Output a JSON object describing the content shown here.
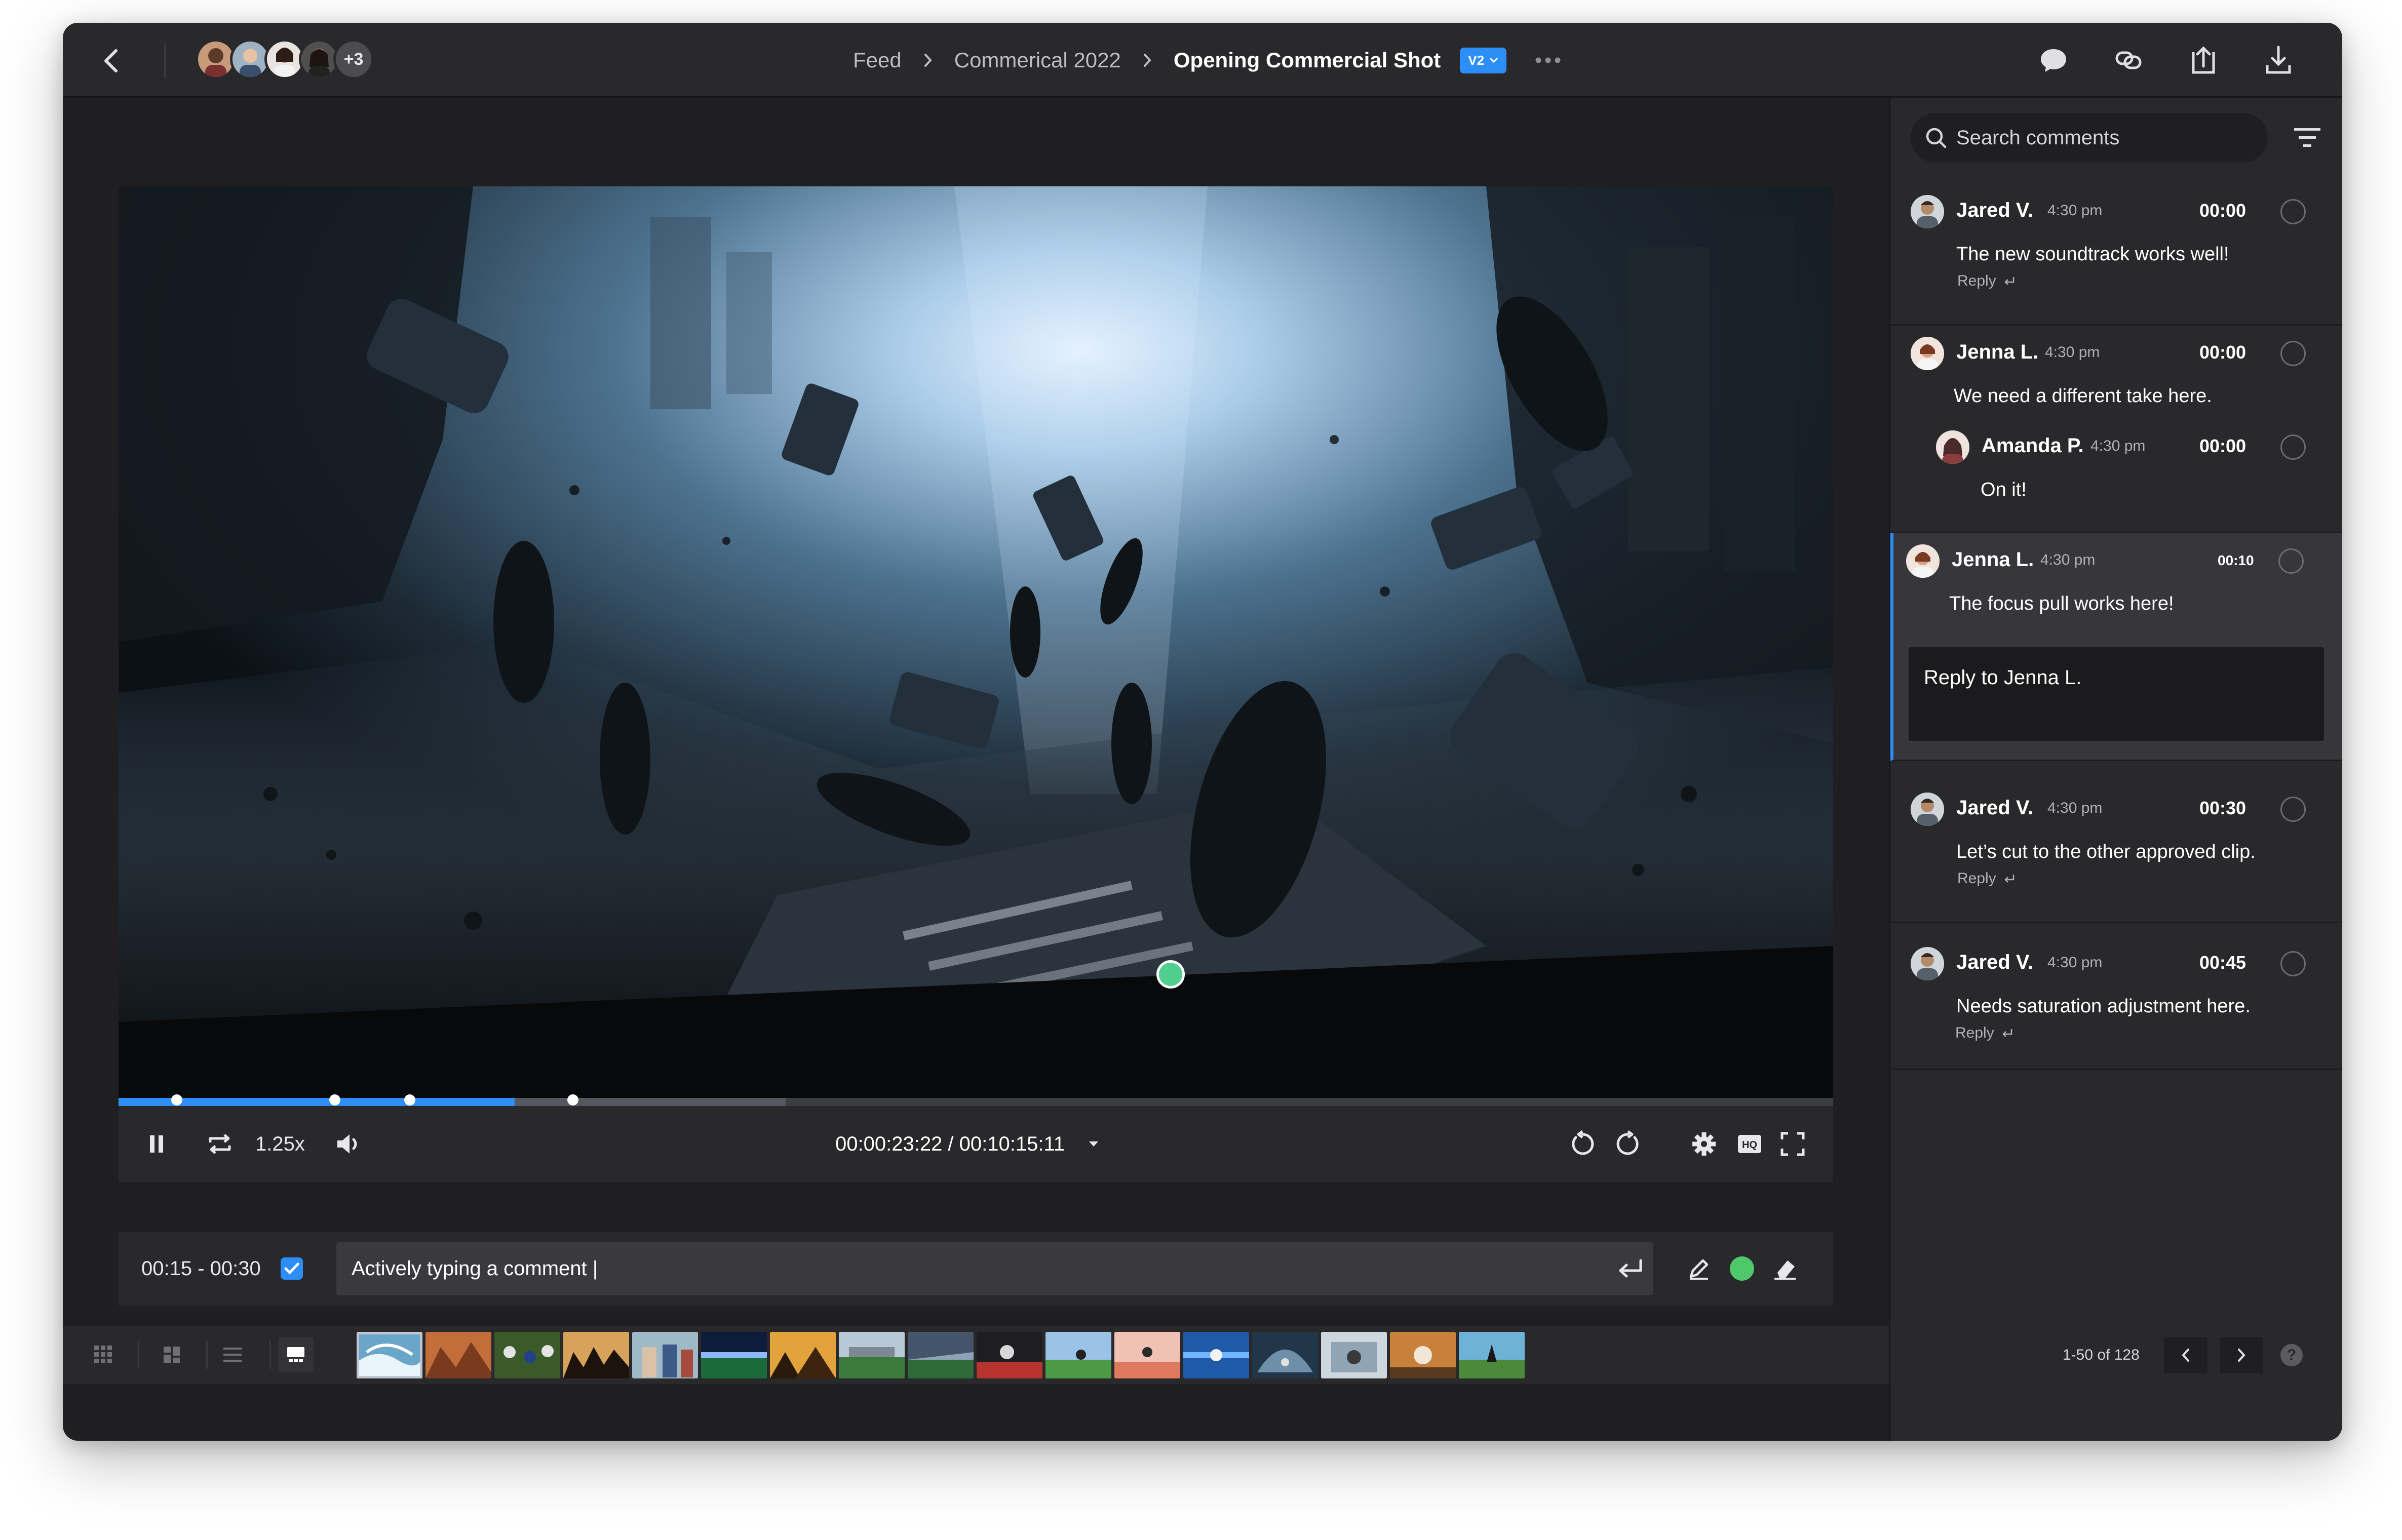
{
  "topbar": {
    "breadcrumb": [
      "Feed",
      "Commerical 2022",
      "Opening Commercial Shot"
    ],
    "version": "V2",
    "collaborators_more": "+3",
    "icons": [
      "back-arrow-icon",
      "comments-icon",
      "link-icon",
      "share-upload-icon",
      "download-icon"
    ]
  },
  "player": {
    "speed": "1.25x",
    "timecode": "00:00:23:22 / 00:10:15:11",
    "progress_played": 0.231,
    "progress_buffered": 0.389,
    "marker_positions": [
      0.034,
      0.126,
      0.17,
      0.265
    ],
    "comment_pin_color": "#4fcf8b"
  },
  "composer": {
    "range": "00:15 - 00:30",
    "value": "Actively typing a comment |",
    "color": "#4ec86b"
  },
  "panel": {
    "search_placeholder": "Search comments",
    "reply_label": "Reply",
    "reply_box_placeholder": "Reply to Jenna L.",
    "threads": [
      {
        "name": "Jared V.",
        "time": "4:30 pm",
        "stamp": "00:00",
        "text": "The new soundtrack works well!"
      },
      {
        "name": "Jenna L.",
        "time": "4:30 pm",
        "stamp": "00:00",
        "text": "We need a different take here.",
        "reply": {
          "name": "Amanda P.",
          "time": "4:30 pm",
          "stamp": "00:00",
          "text": "On it!"
        }
      },
      {
        "name": "Jenna L.",
        "time": "4:30 pm",
        "stamp": "00:10",
        "text": "The focus pull works here!"
      },
      {
        "name": "Jared V.",
        "time": "4:30 pm",
        "stamp": "00:30",
        "text": "Let’s cut to the other approved clip."
      },
      {
        "name": "Jared V.",
        "time": "4:30 pm",
        "stamp": "00:45",
        "text": "Needs saturation adjustment here."
      }
    ]
  },
  "pager": {
    "range": "1-50 of 128"
  },
  "colors": {
    "accent": "#2e8ef7",
    "app_bg": "#1f1f21",
    "bar_bg": "#29292c"
  }
}
